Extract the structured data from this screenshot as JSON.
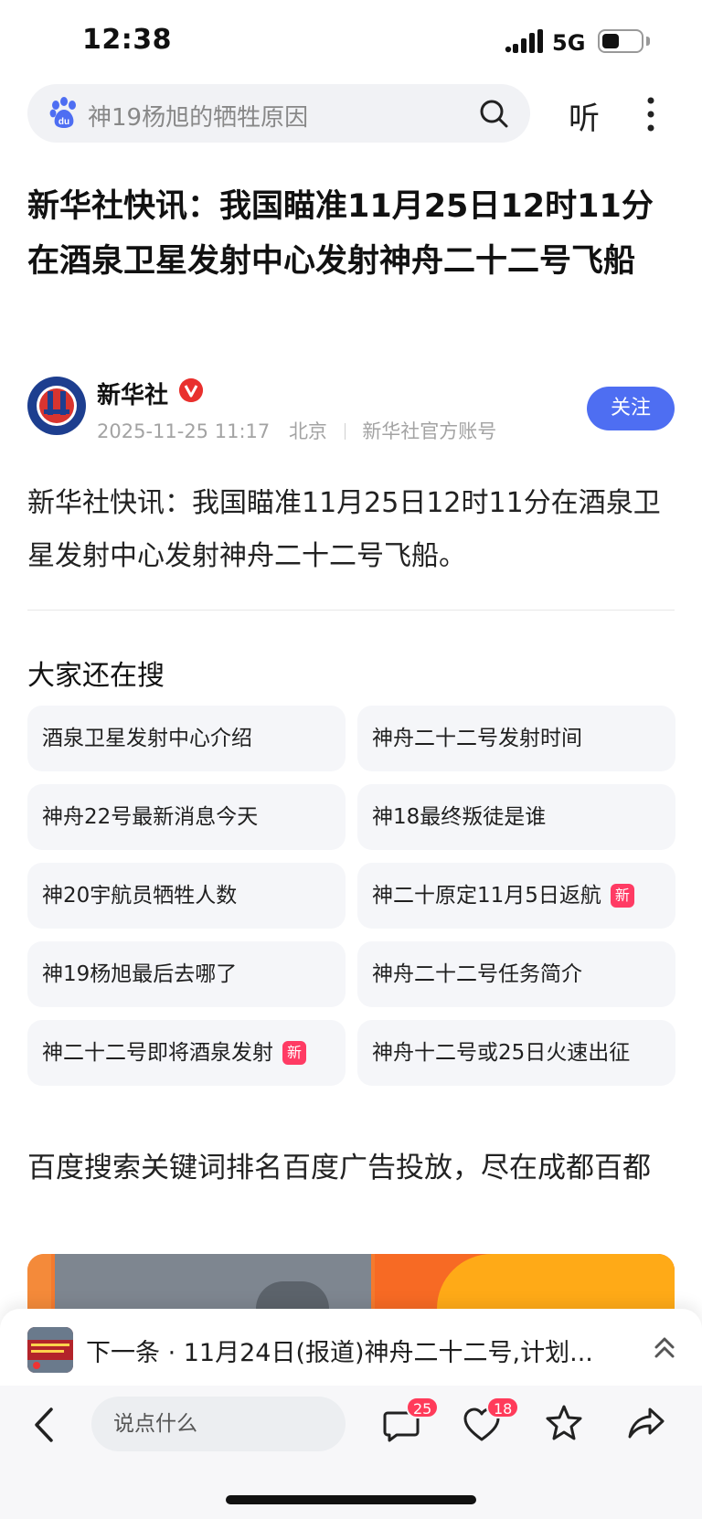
{
  "status_bar": {
    "time": "12:38",
    "network": "5G",
    "battery_level": 0.35
  },
  "search_bar": {
    "query": "神19杨旭的牺牲原因",
    "listen_label": "听"
  },
  "article": {
    "title": "新华社快讯：我国瞄准11月25日12时11分在酒泉卫星发射中心发射神舟二十二号飞船",
    "author": "新华社",
    "datetime": "2025-11-25 11:17",
    "location": "北京",
    "account_type": "新华社官方账号",
    "follow_label": "关注",
    "body": "新华社快讯：我国瞄准11月25日12时11分在酒泉卫星发射中心发射神舟二十二号飞船。"
  },
  "related": {
    "title": "大家还在搜",
    "new_badge": "新",
    "items": [
      {
        "label": "酒泉卫星发射中心介绍"
      },
      {
        "label": "神舟二十二号发射时间"
      },
      {
        "label": "神舟22号最新消息今天"
      },
      {
        "label": "神18最终叛徒是谁"
      },
      {
        "label": "神20宇航员牺牲人数"
      },
      {
        "label": "神二十原定11月5日返航",
        "is_new": true
      },
      {
        "label": "神19杨旭最后去哪了"
      },
      {
        "label": "神舟二十二号任务简介"
      },
      {
        "label": "神二十二号即将酒泉发射",
        "is_new": true
      },
      {
        "label": "神舟十二号或25日火速出征"
      }
    ]
  },
  "ad": {
    "title": "百度搜索关键词排名百度广告投放，尽在成都百都"
  },
  "next_article": {
    "text": "下一条 · 11月24日(报道)神舟二十二号,计划..."
  },
  "toolbar": {
    "comment_placeholder": "说点什么",
    "comment_count": "25",
    "like_count": "18"
  },
  "colors": {
    "accent": "#4e6ef2",
    "badge": "#ff3b5a",
    "new_tag": "#ff3b64"
  }
}
